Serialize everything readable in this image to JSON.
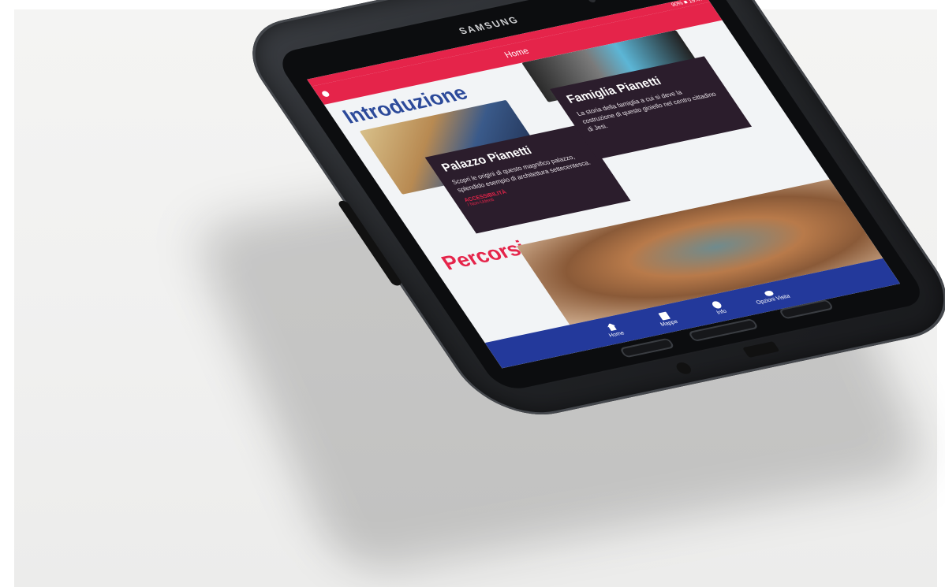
{
  "device": {
    "brand": "SAMSUNG"
  },
  "status": {
    "text": "90% ■ 19:47"
  },
  "appbar": {
    "title": "Home"
  },
  "sections": {
    "intro_title": "Introduzione",
    "percorsi_title": "Percorsi"
  },
  "cards": [
    {
      "title": "Palazzo Pianetti",
      "body": "Scopri le origini di questo magnifico palazzo, splendido esempio di architettura settecentesca.",
      "accent": "ACCESSIBILITÀ",
      "accent2": "/ Non-Udenti"
    },
    {
      "title": "Famiglia Pianetti",
      "body": "La storia della famiglia a cui si deve la costruzione di questo gioiello nel centro cittadino di Jesi."
    }
  ],
  "bottom_nav": [
    {
      "label": "Home",
      "icon": "home-icon"
    },
    {
      "label": "Mappe",
      "icon": "map-icon"
    },
    {
      "label": "Info",
      "icon": "info-icon"
    },
    {
      "label": "Opzioni Visita",
      "icon": "eye-icon"
    }
  ]
}
